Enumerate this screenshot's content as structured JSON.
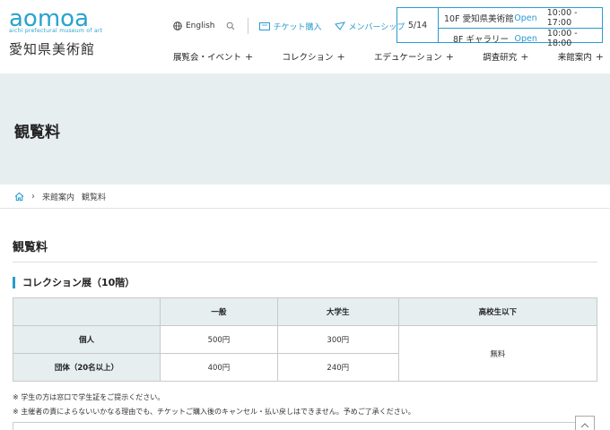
{
  "logo": {
    "mark": "aomoa",
    "sub": "aichi prefectural museum of art",
    "jp": "愛知県美術館"
  },
  "util": {
    "language": "English",
    "ticket": "チケット購入",
    "membership": "メンバーシップ"
  },
  "hours": {
    "date": "5/14",
    "rows": [
      {
        "floor": "10F 愛知県美術館",
        "status": "Open",
        "time": "10:00 - 17:00"
      },
      {
        "floor": "8F ギャラリー",
        "status": "Open",
        "time": "10:00 - 18:00"
      }
    ]
  },
  "nav": [
    {
      "label": "展覧会・イベント"
    },
    {
      "label": "コレクション"
    },
    {
      "label": "エデュケーション"
    },
    {
      "label": "調査研究"
    },
    {
      "label": "来館案内"
    }
  ],
  "page_title": "観覧料",
  "breadcrumb": {
    "parent": "来館案内",
    "current": "観覧料"
  },
  "section_title": "観覧料",
  "subsection_title": "コレクション展（10階）",
  "table": {
    "headers": [
      "一般",
      "大学生",
      "高校生以下"
    ],
    "rows": [
      {
        "label": "個人",
        "general": "500円",
        "univ": "300円"
      },
      {
        "label": "団体（20名以上）",
        "general": "400円",
        "univ": "240円"
      }
    ],
    "free": "無料"
  },
  "notes": [
    "※ 学生の方は窓口で学生証をご提示ください。",
    "※ 主催者の責によらないいかなる理由でも、チケットご購入後のキャンセル・払い戻しはできません。予めご了承ください。"
  ],
  "colors": {
    "accent": "#2a9bd0",
    "band": "#e6eef0"
  }
}
